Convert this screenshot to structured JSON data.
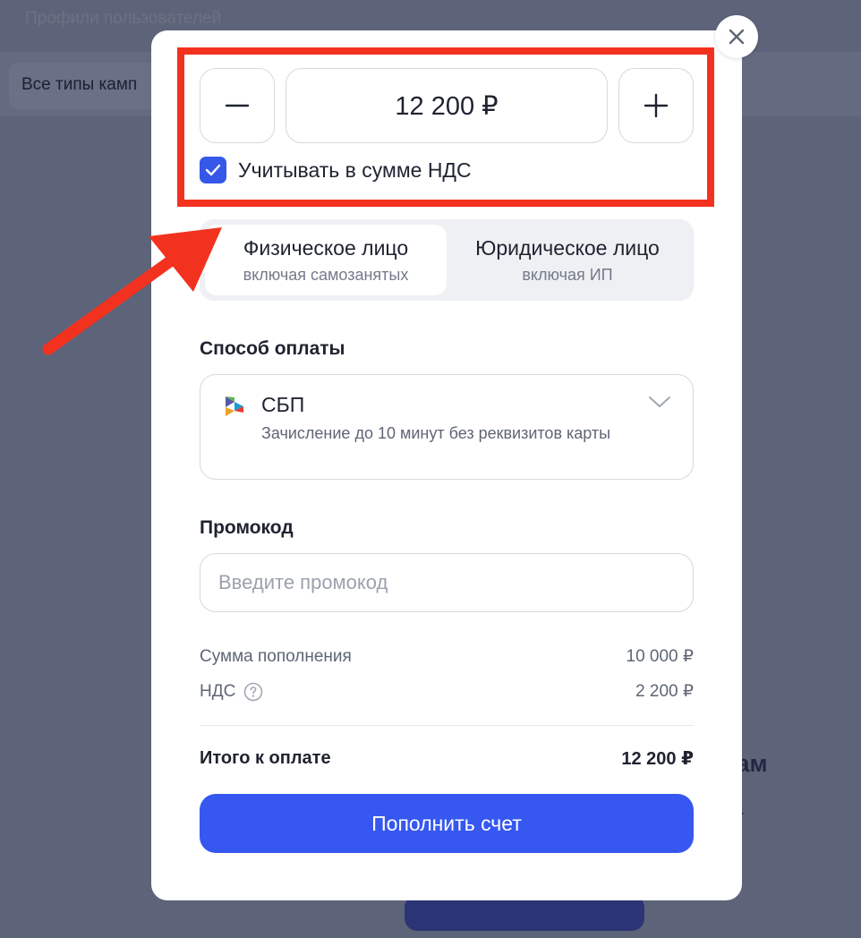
{
  "background": {
    "page_title": "Профили пользователей",
    "filter_label": "Все типы камп",
    "heading_fragment": "рам",
    "dot_fragment": "."
  },
  "topup": {
    "amount": "12 200 ₽",
    "minus_symbol": "−",
    "plus_symbol": "+",
    "vat_checkbox_label": "Учитывать в сумме НДС",
    "vat_checked": true
  },
  "payer_type": {
    "options": [
      {
        "title": "Физическое лицо",
        "subtitle": "включая самозанятых",
        "selected": true
      },
      {
        "title": "Юридическое лицо",
        "subtitle": "включая ИП",
        "selected": false
      }
    ]
  },
  "payment_method": {
    "label": "Способ оплаты",
    "selected_name": "СБП",
    "selected_description": "Зачисление до 10 минут без реквизитов карты"
  },
  "promo": {
    "label": "Промокод",
    "placeholder": "Введите промокод"
  },
  "summary": {
    "topup_label": "Сумма пополнения",
    "topup_value": "10 000 ₽",
    "vat_label": "НДС",
    "vat_value": "2 200 ₽",
    "total_label": "Итого к оплате",
    "total_value": "12 200 ₽"
  },
  "submit_label": "Пополнить счет",
  "colors": {
    "accent": "#3658f0",
    "highlight": "#f2321f",
    "overlay": "#5d6379"
  },
  "icons": {
    "close": "close-icon",
    "check": "check-icon",
    "sbp": "sbp-logo-icon",
    "chevron": "chevron-down-icon",
    "help": "question-circle-icon",
    "arrow": "annotation-arrow"
  }
}
